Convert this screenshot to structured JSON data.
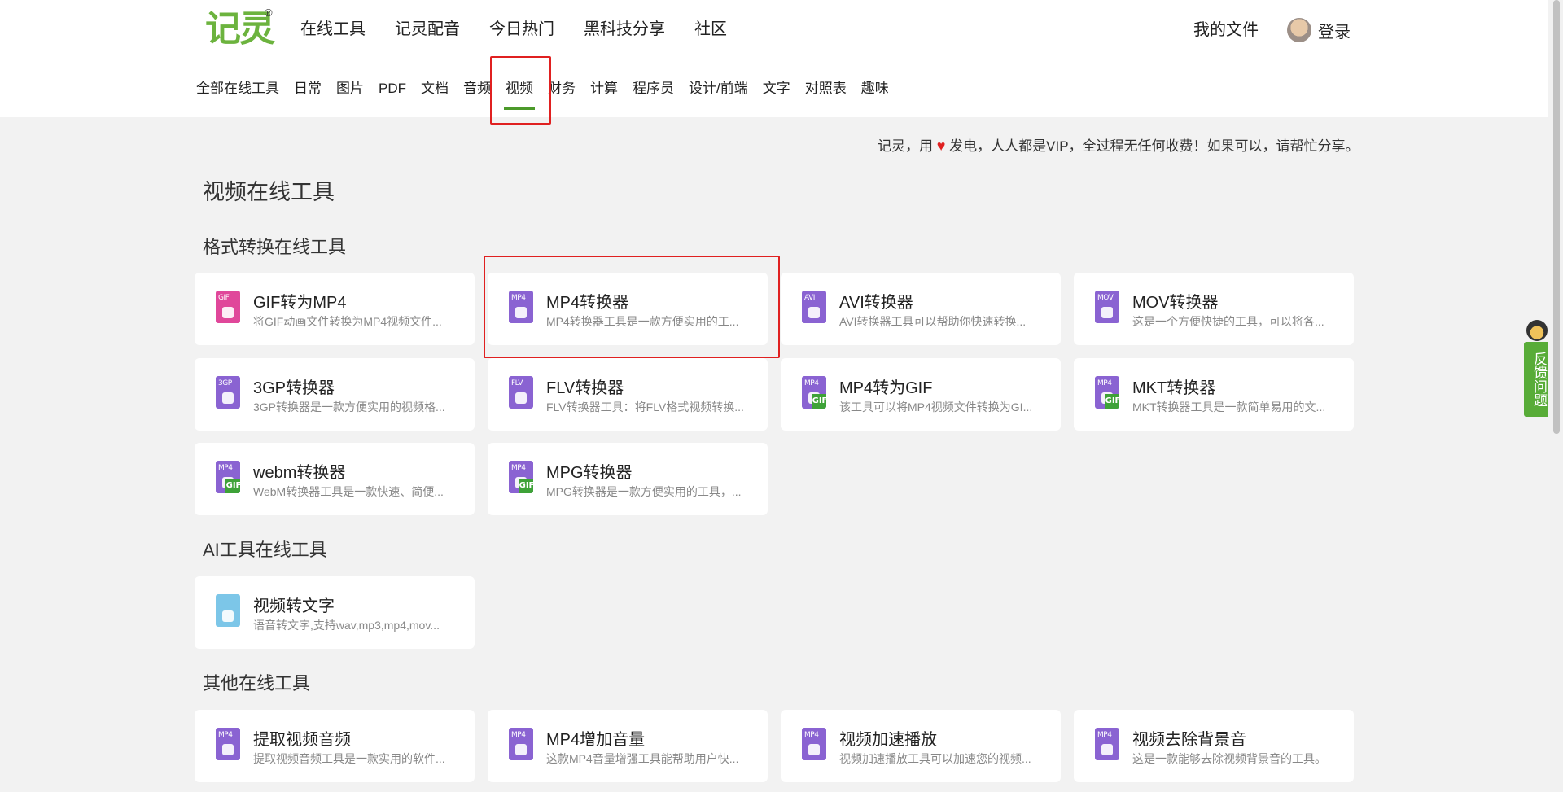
{
  "logo": {
    "text": "记灵",
    "reg": "®"
  },
  "main_nav": [
    "在线工具",
    "记灵配音",
    "今日热门",
    "黑科技分享",
    "社区"
  ],
  "right_nav": {
    "my_files": "我的文件",
    "login": "登录"
  },
  "categories": [
    "全部在线工具",
    "日常",
    "图片",
    "PDF",
    "文档",
    "音频",
    "视频",
    "财务",
    "计算",
    "程序员",
    "设计/前端",
    "文字",
    "对照表",
    "趣味"
  ],
  "active_category": "视频",
  "notice": {
    "before": "记灵，用",
    "heart": "♥",
    "after": "发电，人人都是VIP，全过程无任何收费！如果可以，请帮忙分享。"
  },
  "page_title": "视频在线工具",
  "sections": [
    {
      "title": "格式转换在线工具",
      "cards": [
        {
          "title": "GIF转为MP4",
          "desc": "将GIF动画文件转换为MP4视频文件...",
          "icon": "gif-file-icon",
          "icon_label": "GIF",
          "color": "#e0479a"
        },
        {
          "title": "MP4转换器",
          "desc": "MP4转换器工具是一款方便实用的工...",
          "icon": "mp4-file-icon",
          "icon_label": "MP4",
          "color": "#8a63d2"
        },
        {
          "title": "AVI转换器",
          "desc": "AVI转换器工具可以帮助你快速转换...",
          "icon": "avi-file-icon",
          "icon_label": "AVI",
          "color": "#8a63d2"
        },
        {
          "title": "MOV转换器",
          "desc": "这是一个方便快捷的工具，可以将各...",
          "icon": "mov-file-icon",
          "icon_label": "MOV",
          "color": "#8a63d2"
        },
        {
          "title": "3GP转换器",
          "desc": "3GP转换器是一款方便实用的视频格...",
          "icon": "3gp-file-icon",
          "icon_label": "3GP",
          "color": "#8a63d2"
        },
        {
          "title": "FLV转换器",
          "desc": "FLV转换器工具：将FLV格式视频转换...",
          "icon": "flv-file-icon",
          "icon_label": "FLV",
          "color": "#8a63d2"
        },
        {
          "title": "MP4转为GIF",
          "desc": "该工具可以将MP4视频文件转换为GI...",
          "icon": "mp4-gif-file-icon",
          "icon_label": "MP4",
          "badge": "GIF",
          "color": "#8a63d2"
        },
        {
          "title": "MKT转换器",
          "desc": "MKT转换器工具是一款简单易用的文...",
          "icon": "mkt-file-icon",
          "icon_label": "MP4",
          "badge": "GIF",
          "color": "#8a63d2"
        },
        {
          "title": "webm转换器",
          "desc": "WebM转换器工具是一款快速、简便...",
          "icon": "webm-file-icon",
          "icon_label": "MP4",
          "badge": "GIF",
          "color": "#8a63d2"
        },
        {
          "title": "MPG转换器",
          "desc": "MPG转换器是一款方便实用的工具，...",
          "icon": "mpg-file-icon",
          "icon_label": "MP4",
          "badge": "GIF",
          "color": "#8a63d2"
        }
      ]
    },
    {
      "title": "AI工具在线工具",
      "cards": [
        {
          "title": "视频转文字",
          "desc": "语音转文字,支持wav,mp3,mp4,mov...",
          "icon": "image-file-icon",
          "icon_label": "",
          "color": "#7cc6e8"
        }
      ]
    },
    {
      "title": "其他在线工具",
      "cards": [
        {
          "title": "提取视频音频",
          "desc": "提取视频音频工具是一款实用的软件...",
          "icon": "extract-audio-icon",
          "icon_label": "MP4",
          "color": "#8a63d2"
        },
        {
          "title": "MP4增加音量",
          "desc": "这款MP4音量增强工具能帮助用户快...",
          "icon": "volume-up-icon",
          "icon_label": "MP4",
          "color": "#8a63d2"
        },
        {
          "title": "视频加速播放",
          "desc": "视频加速播放工具可以加速您的视频...",
          "icon": "speed-up-icon",
          "icon_label": "MP4",
          "color": "#8a63d2"
        },
        {
          "title": "视频去除背景音",
          "desc": "这是一款能够去除视频背景音的工具。",
          "icon": "remove-bg-audio-icon",
          "icon_label": "MP4",
          "color": "#8a63d2"
        }
      ]
    }
  ],
  "feedback": "反馈问题"
}
